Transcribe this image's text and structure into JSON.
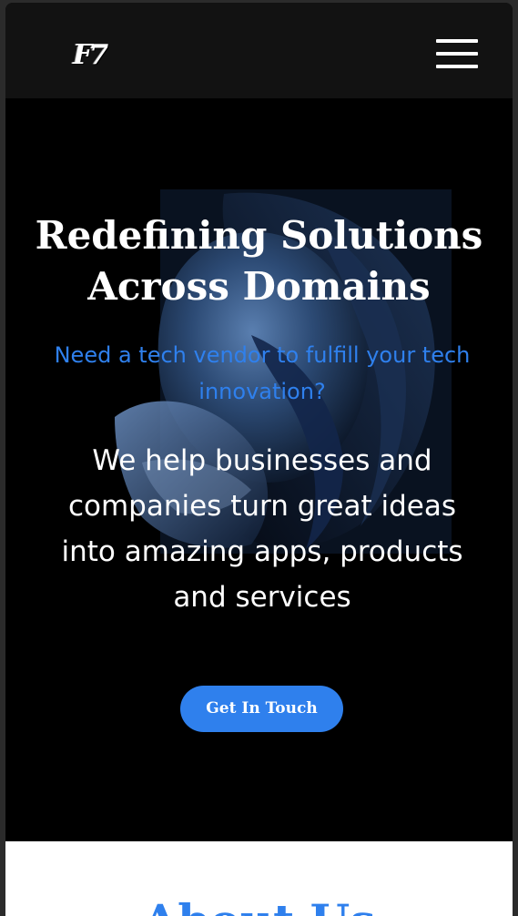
{
  "navbar": {
    "logo_text": "F7",
    "menu_icon": "hamburger-menu-icon"
  },
  "hero": {
    "title": "Redefining Solutions Across Domains",
    "subtitle": "Need a tech vendor to fulfill your tech innovation?",
    "description": "We help businesses and companies turn great ideas into amazing apps, products and services",
    "cta_label": "Get In Touch"
  },
  "about": {
    "title": "About Us"
  },
  "colors": {
    "accent": "#2f80ed",
    "navbar_bg": "#121212",
    "hero_bg": "#000000",
    "about_bg": "#ffffff"
  }
}
